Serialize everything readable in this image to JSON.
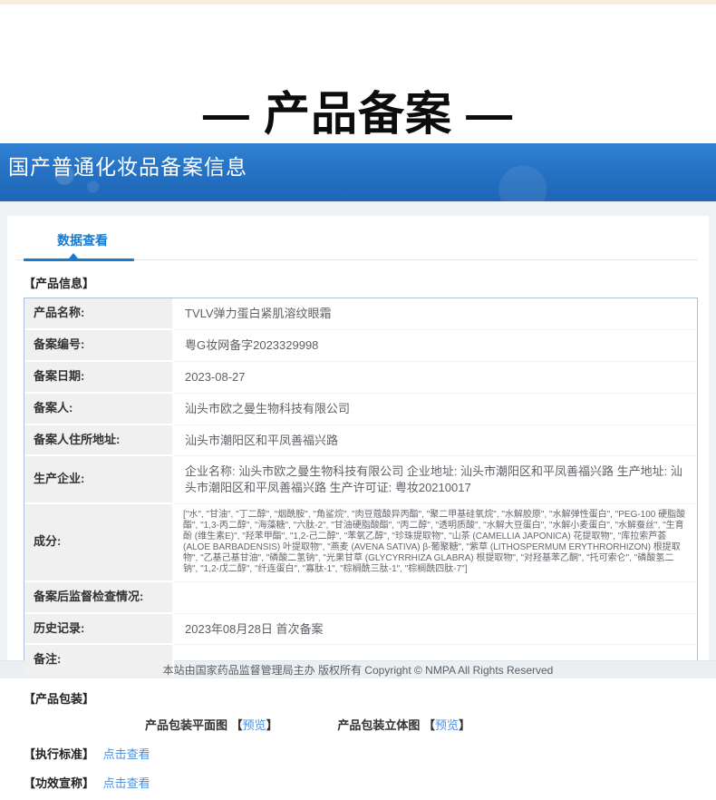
{
  "page": {
    "hero_title": "— 产品备案 —",
    "banner_title": "国产普通化妆品备案信息",
    "tab_label": "数据查看",
    "footer_text": "本站由国家药品监督管理局主办 版权所有 Copyright © NMPA All Rights Reserved"
  },
  "colors": {
    "accent_blue": "#1a7bcd",
    "banner_blue_top": "#3181d2",
    "banner_blue_bottom": "#1f66b6",
    "link_blue": "#4a90e2",
    "top_strip_cream": "#f8ecda",
    "label_cell_gray": "#f0f0f0",
    "table_border_blue": "#a9c0e2"
  },
  "sections": {
    "product_info_heading": "【产品信息】",
    "product_packaging_heading": "【产品包装】",
    "exec_standard_heading": "【执行标准】",
    "efficacy_heading": "【功效宣称】",
    "packaging_flat_label": "产品包装平面图",
    "packaging_3d_label": "产品包装立体图",
    "bracket_open": "【",
    "bracket_close": "】",
    "preview_link_label": "预览",
    "view_link_label": "点击查看"
  },
  "product_table": {
    "rows": [
      {
        "label": "产品名称:",
        "value": "TVLV弹力蛋白紧肌溶纹眼霜"
      },
      {
        "label": "备案编号:",
        "value": "粤G妆网备字2023329998"
      },
      {
        "label": "备案日期:",
        "value": "2023-08-27"
      },
      {
        "label": "备案人:",
        "value": "汕头市欧之曼生物科技有限公司"
      },
      {
        "label": "备案人住所地址:",
        "value": "汕头市潮阳区和平凤善福兴路"
      },
      {
        "label": "生产企业:",
        "value": "企业名称: 汕头市欧之曼生物科技有限公司 企业地址: 汕头市潮阳区和平凤善福兴路 生产地址: 汕头市潮阳区和平凤善福兴路 生产许可证: 粤妆20210017"
      },
      {
        "label": "成分:",
        "value": "[\"水\", \"甘油\", \"丁二醇\", \"烟酰胺\", \"角鲨烷\", \"肉豆蔻酸异丙酯\", \"聚二甲基硅氧烷\", \"水解胶原\", \"水解弹性蛋白\", \"PEG-100 硬脂酸酯\", \"1,3-丙二醇\", \"海藻糖\", \"六肽-2\", \"甘油硬脂酸酯\", \"丙二醇\", \"透明质酸\", \"水解大豆蛋白\", \"水解小麦蛋白\", \"水解蚕丝\", \"生育酚 (维生素E)\", \"羟苯甲酯\", \"1,2-己二醇\", \"苯氧乙醇\", \"珍珠提取物\", \"山茶 (CAMELLIA JAPONICA) 花提取物\", \"库拉索芦荟 (ALOE BARBADENSIS) 叶提取物\", \"燕麦 (AVENA SATIVA) β-葡聚糖\", \"紫草 (LITHOSPERMUM ERYTHRORHIZON) 根提取物\", \"乙基己基甘油\", \"磷酸二氢钠\", \"光果甘草 (GLYCYRRHIZA GLABRA) 根提取物\", \"对羟基苯乙酮\", \"托可索仑\", \"磷酸氢二钠\", \"1,2-戊二醇\", \"纤连蛋白\", \"寡肽-1\", \"棕榈酰三肽-1\", \"棕榈酰四肽-7\"]",
        "small": true
      },
      {
        "label": "备案后监督检查情况:",
        "value": ""
      },
      {
        "label": "历史记录:",
        "value": "2023年08月28日 首次备案"
      },
      {
        "label": "备注:",
        "value": ""
      }
    ]
  }
}
